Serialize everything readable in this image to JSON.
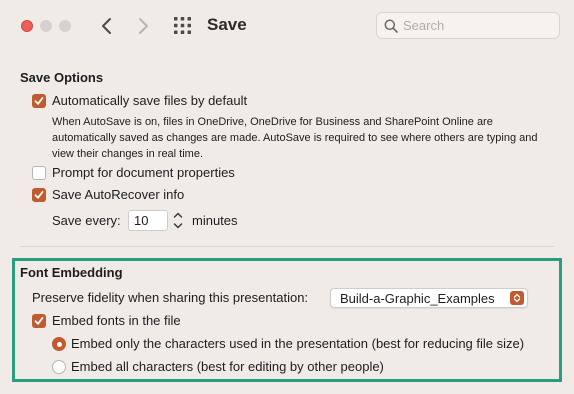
{
  "window": {
    "title": "Save"
  },
  "search": {
    "placeholder": "Search",
    "value": ""
  },
  "save_options": {
    "heading": "Save Options",
    "autosave": {
      "label": "Automatically save files by default",
      "checked": true
    },
    "autosave_description": "When AutoSave is on, files in OneDrive, OneDrive for Business and SharePoint Online are automatically saved as changes are made. AutoSave is required to see where others are typing and view their changes in real time.",
    "prompt_properties": {
      "label": "Prompt for document properties",
      "checked": false
    },
    "autorecover": {
      "label": "Save AutoRecover info",
      "checked": true
    },
    "save_every": {
      "label": "Save every:",
      "value": "10",
      "unit": "minutes"
    }
  },
  "font_embedding": {
    "heading": "Font Embedding",
    "preserve_label": "Preserve fidelity when sharing this presentation:",
    "preserve_value": "Build-a-Graphic_Examples",
    "embed_fonts": {
      "label": "Embed fonts in the file",
      "checked": true
    },
    "options": [
      {
        "label": "Embed only the characters used in the presentation (best for reducing file size)",
        "selected": true
      },
      {
        "label": "Embed all characters (best for editing by other people)",
        "selected": false
      }
    ]
  },
  "colors": {
    "accent": "#c25a2f",
    "highlight": "#2a9d80",
    "background": "#f1ebe8"
  }
}
